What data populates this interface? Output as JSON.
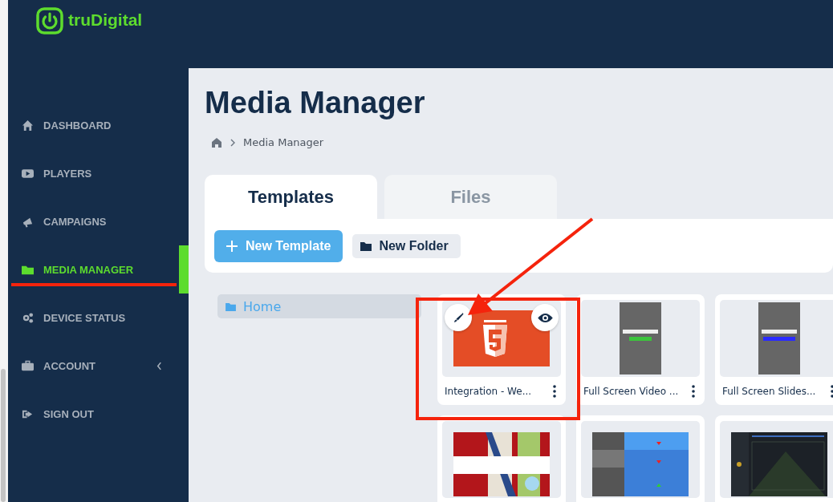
{
  "brand": {
    "name": "truDigital"
  },
  "sidebar": {
    "items": [
      {
        "label": "DASHBOARD",
        "kind": "home",
        "selected": false,
        "submenu": false
      },
      {
        "label": "PLAYERS",
        "kind": "play",
        "selected": false,
        "submenu": false
      },
      {
        "label": "CAMPAIGNS",
        "kind": "megaphone",
        "selected": false,
        "submenu": false
      },
      {
        "label": "MEDIA MANAGER",
        "kind": "folder",
        "selected": true,
        "submenu": false
      },
      {
        "label": "DEVICE STATUS",
        "kind": "gears",
        "selected": false,
        "submenu": false
      },
      {
        "label": "ACCOUNT",
        "kind": "briefcase",
        "selected": false,
        "submenu": true
      },
      {
        "label": "SIGN OUT",
        "kind": "signout",
        "selected": false,
        "submenu": false
      }
    ]
  },
  "page": {
    "title": "Media Manager",
    "breadcrumb": [
      "Media Manager"
    ]
  },
  "tabs": [
    {
      "label": "Templates",
      "selected": true
    },
    {
      "label": "Files",
      "selected": false
    }
  ],
  "toolbar": {
    "buttons": [
      {
        "label": "New Template",
        "kind": "primary"
      },
      {
        "label": "New Folder",
        "kind": "folder"
      }
    ]
  },
  "folders": [
    {
      "label": "Home",
      "selected": true
    }
  ],
  "templates": [
    {
      "title": "Integration - We...",
      "kind": "html5",
      "hover": true
    },
    {
      "title": "Full Screen Video ...",
      "kind": "portrait",
      "hover": false
    },
    {
      "title": "Full Screen Slides...",
      "kind": "portrait2",
      "hover": false
    },
    {
      "kind": "holiday",
      "hover": false
    },
    {
      "kind": "ticker",
      "hover": false
    },
    {
      "kind": "table",
      "hover": false
    }
  ]
}
